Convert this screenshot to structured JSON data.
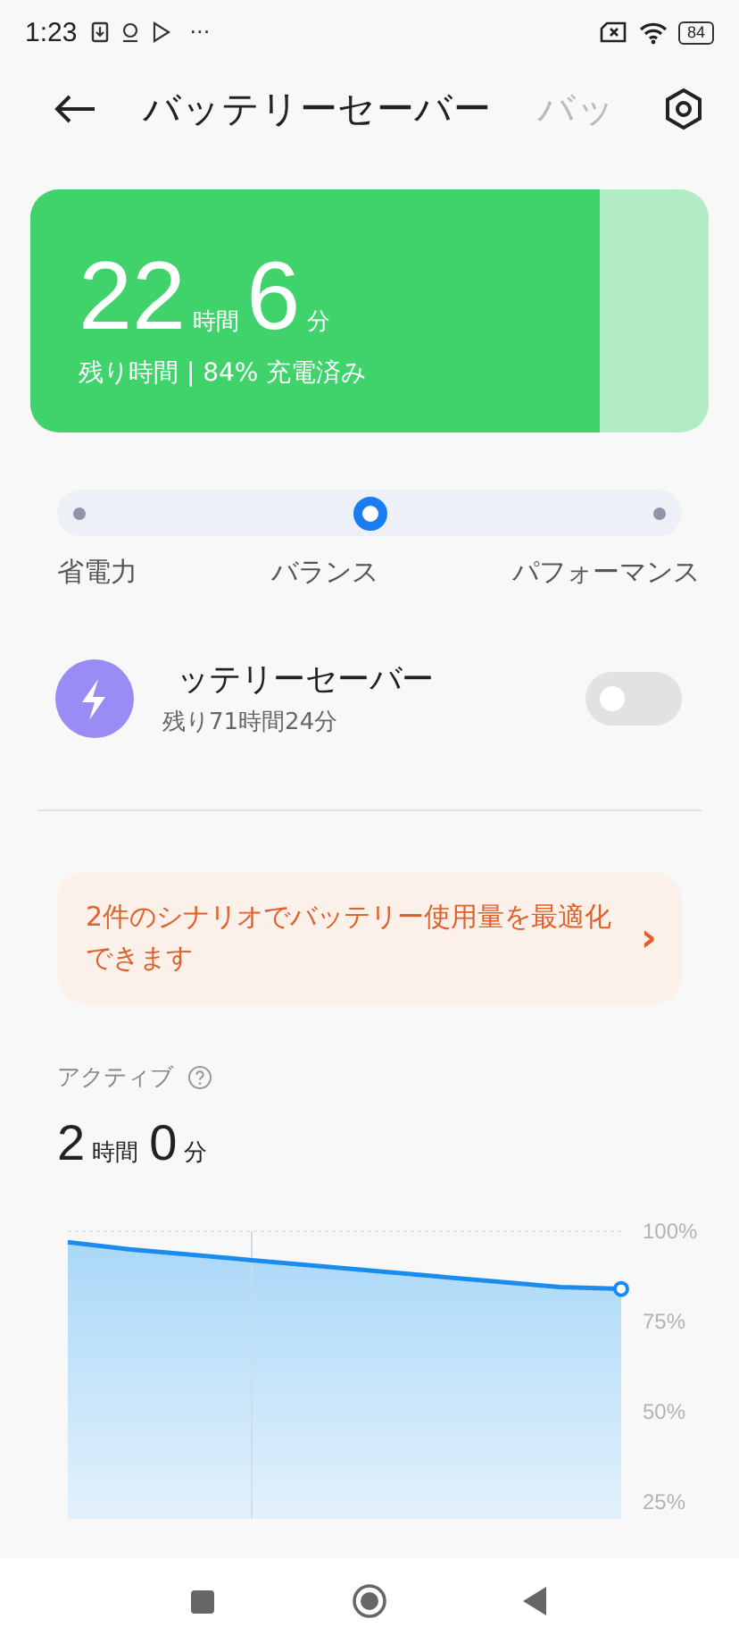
{
  "status_bar": {
    "time": "1:23",
    "more": "···",
    "battery": "84"
  },
  "header": {
    "tabs": [
      {
        "label": "バッテリーセーバー",
        "selected": true
      },
      {
        "label": "バッ",
        "selected": false
      }
    ]
  },
  "battery_card": {
    "hours": "22",
    "hours_unit": "時間",
    "minutes": "6",
    "minutes_unit": "分",
    "caption": "残り時間 | 84% 充電済み",
    "level": 0.84
  },
  "modes": [
    {
      "label": "省電力",
      "selected": false
    },
    {
      "label": "バランス",
      "selected": true
    },
    {
      "label": "パフォーマンス",
      "selected": false
    }
  ],
  "saver": {
    "title": "ッテリーセーバー",
    "subtitle": "残り71時間24分",
    "on": false
  },
  "suggestion": {
    "text": "2件のシナリオでバッテリー使用量を最適化できます",
    "arrow": "›"
  },
  "active": {
    "label": "アクティブ",
    "hours": "2",
    "hours_unit": "時間",
    "minutes": "0",
    "minutes_unit": "分"
  },
  "chart_data": {
    "type": "line",
    "ylim": [
      20.3,
      100
    ],
    "yticks": [
      {
        "value": 100,
        "label": "100%"
      },
      {
        "value": 75,
        "label": "75%"
      },
      {
        "value": 50,
        "label": "50%"
      },
      {
        "value": 25,
        "label": "25%"
      }
    ],
    "series": [
      {
        "color": "#1a8cf0",
        "values": [
          97,
          95,
          93.5,
          92,
          90.5,
          89,
          87.5,
          86,
          84.5,
          84
        ]
      }
    ]
  }
}
